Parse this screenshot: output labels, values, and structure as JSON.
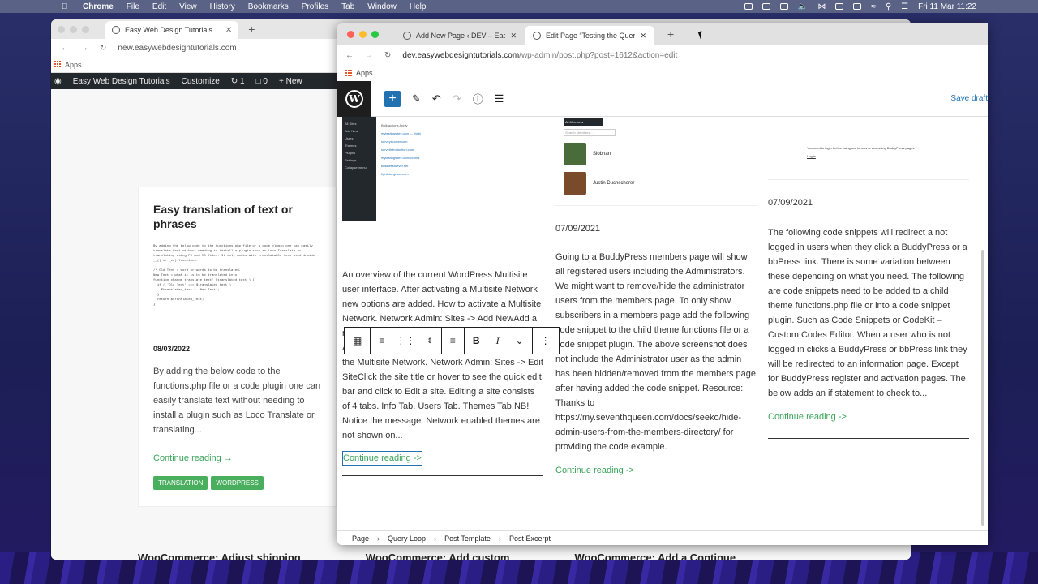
{
  "menubar": {
    "app": "Chrome",
    "items": [
      "File",
      "Edit",
      "View",
      "History",
      "Bookmarks",
      "Profiles",
      "Tab",
      "Window",
      "Help"
    ],
    "clock": "Fri 11 Mar  11:22"
  },
  "back_browser": {
    "tab_title": "Easy Web Design Tutorials",
    "url": "new.easywebdesigntutorials.com",
    "apps_label": "Apps",
    "adminbar": {
      "site": "Easy Web Design Tutorials",
      "customize": "Customize",
      "updates": "1",
      "comments": "0",
      "new": "New"
    },
    "post": {
      "title": "Easy translation of text or phrases",
      "date": "08/03/2022",
      "excerpt": "By adding the below code to the functions.php file or a code plugin one can easily translate text without needing to install a plugin such as Loco Translate or translating...",
      "continue": "Continue reading  →",
      "tags": [
        "TRANSLATION",
        "WORDPRESS"
      ],
      "code_preview": "By adding the below code to the functions.php file or a code plugin one can easily translate text without needing to install a plugin such as Loco Translate or translating using PO and MO files. It only works with translatable text used inside __() or _e() functions.\n\n/* Old Text = word or words to be translated.\nNew Text = what it is to be translated into.\nfunction change_translate_text( $translated_text ) {\n  if ( 'Old Text' === $translated_text ) {\n    $translated_text = 'New Text';\n  }\n  return $translated_text;\n}"
    },
    "bottom_titles": [
      "WooCommerce: Adjust shipping",
      "WooCommerce: Add custom",
      "WooCommerce: Add a Continue"
    ]
  },
  "front_browser": {
    "tabs": [
      {
        "title": "Add New Page ‹ DEV – Easy Web",
        "active": false
      },
      {
        "title": "Edit Page “Testing the Query L",
        "active": true
      }
    ],
    "url_host": "dev.easywebdesigntutorials.com",
    "url_path": "/wp-admin/post.php?post=1612&action=edit",
    "apps_label": "Apps",
    "save_draft": "Save draft",
    "columns": [
      {
        "date": "",
        "text": "An overview of the current WordPress Multisite user interface. After activating a Multisite Network new options are added. How to activate a Multisite Network. Network Admin: Sites -> Add NewAdd a new (sub) site to the Multisite Network. Network Admin: Sites -> All SitesSee a list of all the Sites in the Multisite Network. Network Admin: Sites -> Edit SiteClick the site title or hover to see the quick edit bar and click to Edit a site. Editing a site consists of 4 tabs. Info Tab. Users Tab. Themes Tab.NB! Notice the message: Network enabled themes are not shown on...",
        "link": "Continue reading ->"
      },
      {
        "date": "07/09/2021",
        "text": "Going to a BuddyPress members page will show all registered users including the Administrators. We might want to remove/hide the administrator users from the members page. To only show subscribers in a members page add the following code snippet to the child theme functions file or a code snippet plugin. The above screenshot does not include the Administrator user as the admin has been hidden/removed from the members page after having added the code snippet. Resource: Thanks to https://my.seventhqueen.com/docs/seeko/hide-admin-users-from-the-members-directory/ for providing the code example.",
        "link": "Continue reading ->",
        "members": [
          "Siobhan",
          "Justin Duchscherer"
        ],
        "members_tab": "All Members",
        "search_placeholder": "Search Members..."
      },
      {
        "date": "07/09/2021",
        "text": "The following code snippets will redirect a not logged in users when they click a BuddyPress or a bbPress link. There is some variation between these depending on what you need. The following are code snippets need to be added to a child theme functions.php file or into a code snippet plugin. Such as Code Snippets or CodeKit – Custom Codes Editor. When a user who is not logged in clicks a BuddyPress or bbPress link they will be redirected to an information page. Except for BuddyPress register and activation pages. The below adds an if statement to check to...",
        "link": "Continue reading ->",
        "notice": "You need to login before using our forums or accessing BuddyPress pages.",
        "login": "Log in"
      }
    ],
    "sites_list": {
      "menu": [
        "All Sites",
        "Add New",
        "Users",
        "Themes",
        "Plugins",
        "Settings",
        "Collapse menu"
      ],
      "rows": [
        "mytestingsites.com — Main",
        "surveytrucker.com",
        "survetintroduction.com",
        "mytestingsites.com/forums",
        "businessfoever.net",
        "fightbluegrass.com"
      ],
      "bulk_label": "Bulk actions",
      "apply_label": "Apply"
    },
    "breadcrumb": [
      "Page",
      "Query Loop",
      "Post Template",
      "Post Excerpt"
    ]
  }
}
